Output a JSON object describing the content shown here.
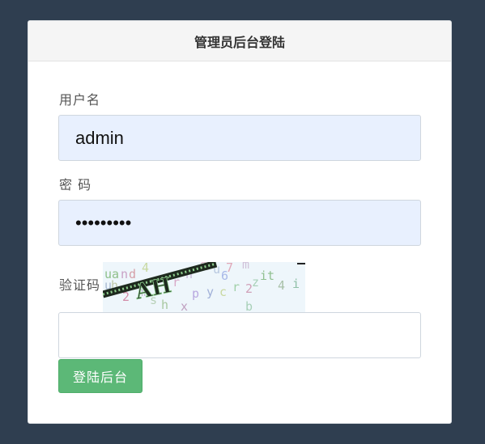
{
  "panel": {
    "title": "管理员后台登陆"
  },
  "form": {
    "username_label": "用户名",
    "username_value": "admin",
    "password_label": "密 码",
    "password_value": "•••••••••",
    "captcha_label": "验证码",
    "captcha_value": "",
    "captcha_image_text": "AH",
    "submit_label": "登陆后台"
  },
  "colors": {
    "page_background": "#2f3e50",
    "autofill_background": "#e8f0fe",
    "button_background": "#5cb877"
  }
}
